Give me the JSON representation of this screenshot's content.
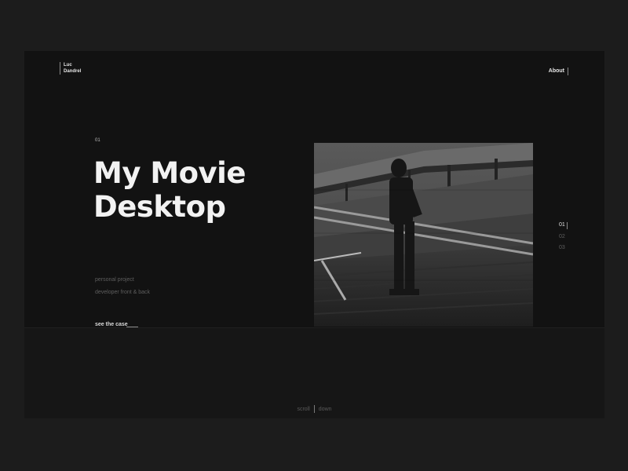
{
  "brand": {
    "line1": "Luc",
    "line2": "Dandrel"
  },
  "nav": {
    "about_label": "About"
  },
  "project": {
    "index": "01",
    "title_line1": "My Movie",
    "title_line2": "Desktop",
    "meta1": "personal project",
    "meta2": "developer front & back",
    "cta_label": "see the case"
  },
  "pager": {
    "items": [
      "01",
      "02",
      "03"
    ],
    "active_index": 0
  },
  "scroll_hint": {
    "left": "scroll",
    "right": "down"
  },
  "colors": {
    "page_background": "#1c1c1c",
    "panel_background": "#121212",
    "text_primary": "#f2f2f2",
    "text_muted": "#5e5e5e"
  },
  "hero_image": {
    "description_icon": "photo-man-on-stadium-stairs-bw"
  }
}
